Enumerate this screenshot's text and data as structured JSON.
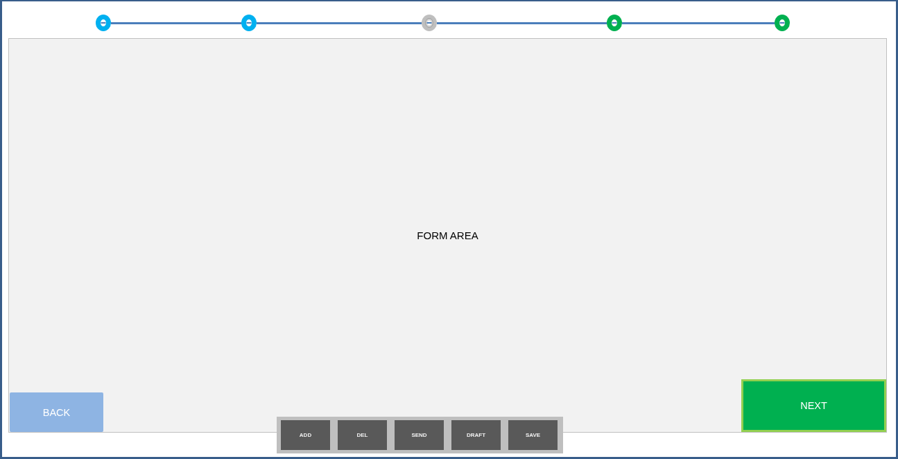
{
  "stepper": {
    "steps": [
      {
        "color": "#00b0f0",
        "current": false
      },
      {
        "color": "#00b0f0",
        "current": false
      },
      {
        "color": "#bfbfbf",
        "current": true
      },
      {
        "color": "#00b050",
        "current": false
      },
      {
        "color": "#00b050",
        "current": false
      }
    ]
  },
  "form_area": {
    "label": "FORM AREA"
  },
  "navigation": {
    "back": {
      "label": "BACK"
    },
    "next": {
      "label": "NEXT"
    }
  },
  "toolbar": {
    "buttons": [
      {
        "label": "ADD"
      },
      {
        "label": "DEL"
      },
      {
        "label": "SEND"
      },
      {
        "label": "DRAFT"
      },
      {
        "label": "SAVE"
      }
    ]
  }
}
